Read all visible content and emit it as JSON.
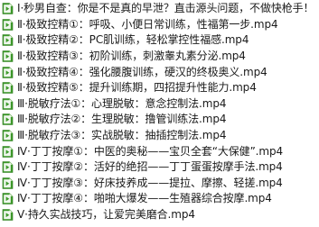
{
  "files": [
    {
      "name": "Ⅰ·秒男自查：你是不是真的早泄？直击源头问题，不做快枪手！"
    },
    {
      "name": "Ⅱ·极致控精①：呼吸、小便日常训练，性福第一步.mp4"
    },
    {
      "name": "Ⅱ·极致控精②：PC肌训练，轻松掌控性福感.mp4"
    },
    {
      "name": "Ⅱ·极致控精③：初阶训练，刺激睾丸素分泌.mp4"
    },
    {
      "name": "Ⅱ·极致控精④：强化腰腹训练，硬汉的终极奥义.mp4"
    },
    {
      "name": "Ⅱ·极致控精⑤：提升训练期，四招提升性能力.mp4"
    },
    {
      "name": "Ⅲ·脱敏疗法①：心理脱敏：意念控制法.mp4"
    },
    {
      "name": "Ⅲ·脱敏疗法②：生理脱敏：撸管训练法.mp4"
    },
    {
      "name": "Ⅲ·脱敏疗法③：实战脱敏：抽插控制法.mp4"
    },
    {
      "name": "Ⅳ·丁丁按摩①：中医的奥秘——宝贝全套“大保健”.mp4"
    },
    {
      "name": "Ⅳ·丁丁按摩②：活好的绝招——丁丁蛋蛋按摩手法.mp4"
    },
    {
      "name": "Ⅳ·丁丁按摩③：好床技养成——提拉、摩擦、轻搓.mp4"
    },
    {
      "name": "Ⅳ·丁丁按摩④：啪啪大爆发——生殖器综合按摩.mp4"
    },
    {
      "name": "Ⅴ·持久实战技巧，让爱完美磨合.mp4"
    }
  ],
  "colors": {
    "icon_fill": "#3d9a2a",
    "icon_fold": "#b7e0a8",
    "text": "#1a1a1a"
  },
  "icon": "video-file-icon"
}
